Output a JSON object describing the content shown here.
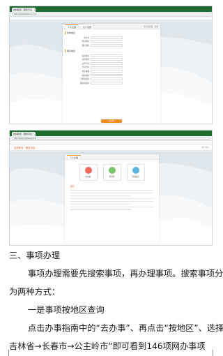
{
  "screenshot1": {
    "browser_tab": "吉林政务 · 服务平台",
    "url": "http://www.jlzwfw.gov.cn/...",
    "panel_tabs": [
      "个人注册",
      "法人注册"
    ],
    "breadcrumb": "您当前位置：注册",
    "section1": "基本信息",
    "section2": "联系信息",
    "fields": [
      "用户名",
      "登录密码",
      "确认密码",
      "真实姓名",
      "证件类型",
      "证件号码",
      "手机号码",
      "电子邮箱",
      "联系地址",
      "手机验证码",
      "图片验证码"
    ],
    "submit": "注 册"
  },
  "screenshot2": {
    "browser_tab": "吉林政务 · 服务平台",
    "url": "http://www.jlzwfw.gov.cn/...",
    "site_logo": "吉林政务 · 服务平台",
    "site_right": "用户中心",
    "panel_tabs": [
      "个人办事"
    ],
    "cards": [
      {
        "label": "去办事",
        "color": "#ee6a5f"
      },
      {
        "label": "查办件",
        "color": "#7cc56a"
      },
      {
        "label": "咨询投诉",
        "color": "#5bb6e0"
      }
    ],
    "notice_title": "提示"
  },
  "text": {
    "heading": "三、事项办理",
    "para1_l1": "事项办理需要先搜索事项，再办理事项。搜索事项分",
    "para1_l2": "为两种方式：",
    "sub1": "一是事项按地区查询",
    "para2_l1": "点击办事指南中的“去办事”、再点击“按地区”、选择“",
    "para2_l2": "吉林省→长春市→公主岭市”即可看到146项网办事项"
  }
}
